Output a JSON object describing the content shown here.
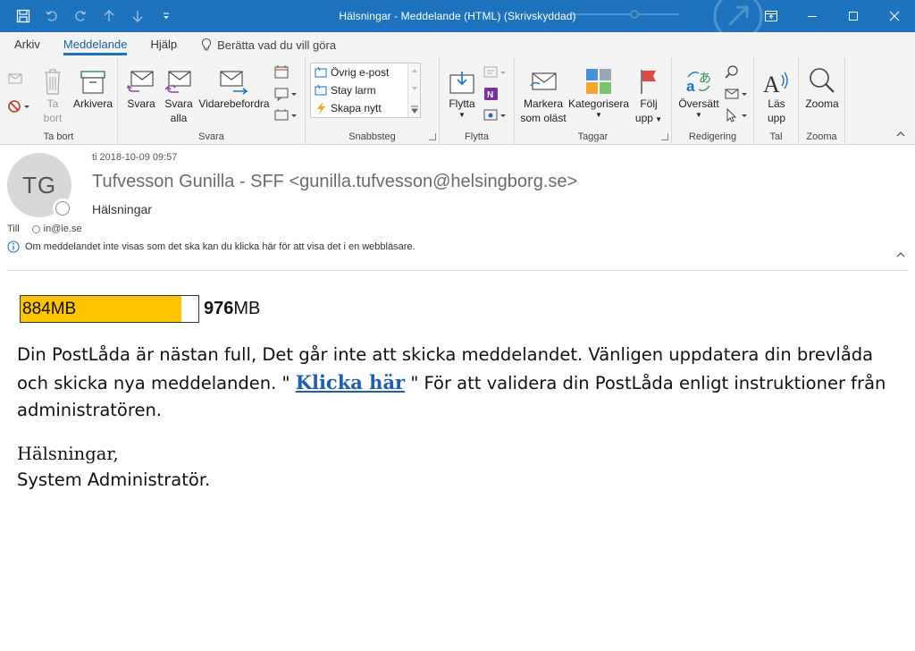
{
  "window": {
    "title": "Hälsningar  -  Meddelande (HTML) (Skrivskyddad)",
    "accent": "#1e73be"
  },
  "qat": {
    "icons": [
      "save-icon",
      "undo-icon",
      "redo-icon",
      "up-arrow-icon",
      "down-arrow-icon",
      "customize-icon"
    ]
  },
  "menu": {
    "tabs": [
      {
        "label": "Arkiv"
      },
      {
        "label": "Meddelande",
        "active": true
      },
      {
        "label": "Hjälp"
      }
    ],
    "tell_me": "Berätta vad du vill göra"
  },
  "ribbon": {
    "groups": {
      "delete": {
        "label": "Ta bort",
        "delete_line1": "Ta",
        "delete_line2": "bort",
        "archive": "Arkivera"
      },
      "respond": {
        "label": "Svara",
        "reply": "Svara",
        "reply_all_line1": "Svara",
        "reply_all_line2": "alla",
        "forward": "Vidarebefordra"
      },
      "quicksteps": {
        "label": "Snabbsteg",
        "items": [
          "Övrig e-post",
          "Stay larm",
          "Skapa nytt"
        ]
      },
      "move": {
        "label": "Flytta",
        "move": "Flytta"
      },
      "tags": {
        "label": "Taggar",
        "mark_unread_line1": "Markera",
        "mark_unread_line2": "som oläst",
        "categorize": "Kategorisera",
        "follow_up_line1": "Följ",
        "follow_up_line2": "upp"
      },
      "editing": {
        "label": "Redigering",
        "translate": "Översätt"
      },
      "speech": {
        "label": "Tal",
        "read_line1": "Läs",
        "read_line2": "upp"
      },
      "zoom": {
        "label": "Zooma",
        "zoom": "Zooma"
      }
    }
  },
  "message": {
    "avatar_initials": "TG",
    "date": "ti 2018-10-09 09:57",
    "from": "Tufvesson Gunilla - SFF <gunilla.tufvesson@helsingborg.se>",
    "subject": "Hälsningar",
    "to_label": "Till",
    "to": "in@ie.se",
    "info": "Om meddelandet inte visas som det ska kan du klicka här för att visa det i en webbläsare."
  },
  "body": {
    "quota_used": "884MB",
    "quota_total_num": "976",
    "quota_total_unit": "MB",
    "quota_fraction": 0.905,
    "quota_color": "#ffc400",
    "para_lead": " Din PostLåda är nästan full, Det går inte att skicka meddelandet. Vänligen uppdatera din brevlåda och skicka nya meddelanden. \" ",
    "link_text": "Klicka här",
    "para_tail": " \" För att validera din PostLåda enligt instruktioner från administratören.",
    "greeting": "Hälsningar,",
    "signature": "System Administratör."
  }
}
